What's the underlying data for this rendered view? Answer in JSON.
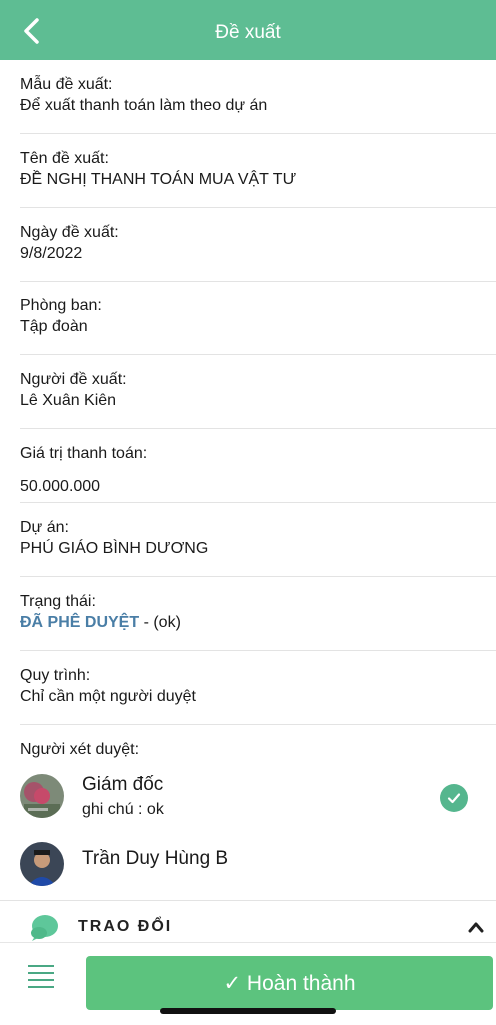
{
  "header": {
    "title": "Đề xuất"
  },
  "fields": [
    {
      "label": "Mẫu đề xuất:",
      "value": "Để xuất thanh toán làm theo dự án"
    },
    {
      "label": "Tên đề xuất:",
      "value": "ĐỀ NGHỊ THANH TOÁN MUA VẬT TƯ"
    },
    {
      "label": "Ngày đề xuất:",
      "value": "9/8/2022"
    },
    {
      "label": "Phòng ban:",
      "value": "Tập đoàn"
    },
    {
      "label": "Người đề xuất:",
      "value": "Lê Xuân Kiên"
    },
    {
      "label": "Giá trị thanh toán:",
      "value": "50.000.000"
    },
    {
      "label": "Dự án:",
      "value": "PHÚ GIÁO BÌNH DƯƠNG"
    },
    {
      "label": "Trạng thái:",
      "status": "ĐÃ PHÊ DUYỆT",
      "status_suffix": " - (ok)"
    },
    {
      "label": "Quy trình:",
      "value": "Chỉ cần một người duyệt"
    }
  ],
  "reviewers": {
    "label": "Người xét duyệt:",
    "items": [
      {
        "name": "Giám đốc",
        "note": "ghi chú : ok",
        "approved": true
      },
      {
        "name": "Trần Duy Hùng B"
      }
    ]
  },
  "exchange": {
    "label": "TRAO ĐỔI"
  },
  "footer": {
    "done_label": "✓ Hoàn thành"
  },
  "colors": {
    "header": "#5ebd93",
    "status": "#4a7ea6",
    "button": "#5cc37e"
  }
}
